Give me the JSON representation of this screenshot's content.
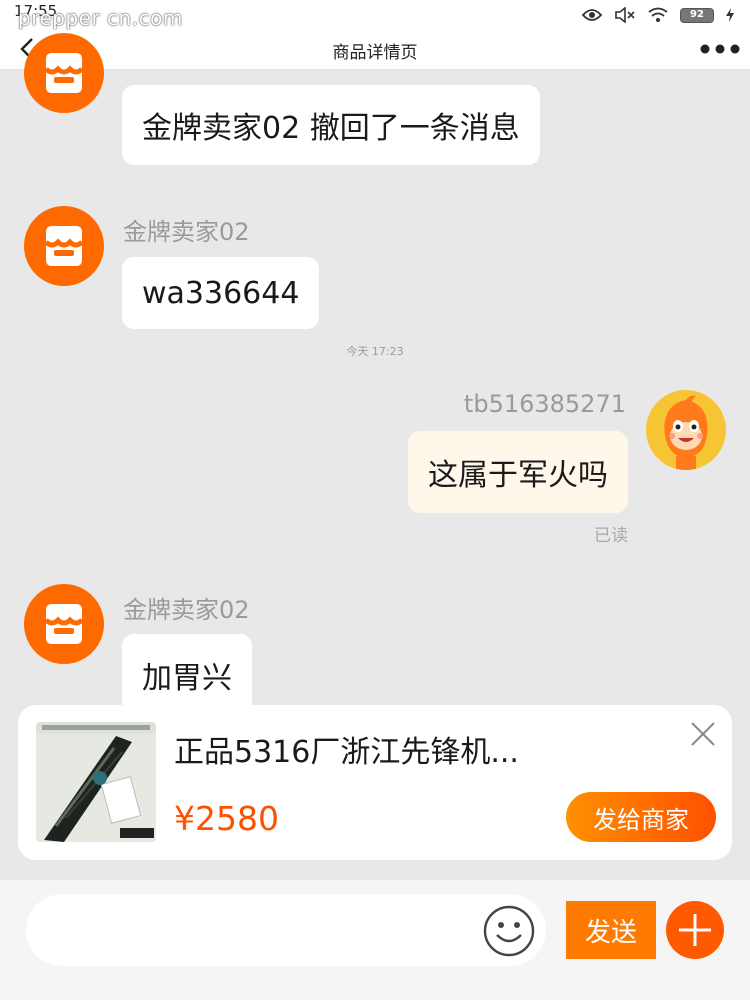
{
  "status_bar": {
    "time": "17:55",
    "watermark": "prepper cn.com",
    "battery": "92",
    "icons": [
      "eye-icon",
      "mute-icon",
      "wifi-icon",
      "battery-icon",
      "charging-icon"
    ]
  },
  "nav": {
    "back_icon": "back-arrow-icon",
    "title": "商品详情页",
    "more_icon": "more-dots-icon"
  },
  "messages": {
    "recall": "金牌卖家02 撤回了一条消息",
    "m1": {
      "sender": "金牌卖家02",
      "text": "wa336644"
    },
    "time_separator": "今天 17:23",
    "m2": {
      "sender": "tb516385271",
      "text": "这属于军火吗",
      "status": "已读"
    },
    "m3": {
      "sender": "金牌卖家02",
      "text": "加胃兴"
    }
  },
  "product": {
    "title": "正品5316厂浙江先锋机...",
    "price": "¥2580",
    "send_label": "发给商家",
    "close_icon": "close-icon"
  },
  "input_bar": {
    "placeholder": "",
    "emoji_icon": "emoji-icon",
    "send_label": "发送",
    "plus_icon": "plus-icon"
  },
  "colors": {
    "accent": "#ff6a00",
    "price": "#ff5000",
    "chat_bg": "#e8e8e8",
    "my_bubble": "#fff8ea"
  }
}
